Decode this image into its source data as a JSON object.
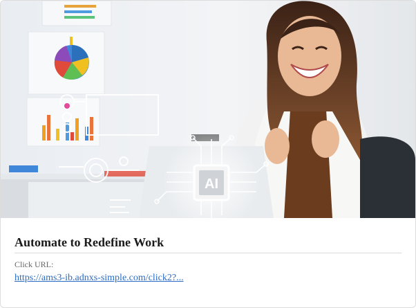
{
  "ad": {
    "image_alt": "Smiling woman celebrating in front of laptop with AI chip graphic",
    "chip_label": "AI",
    "title": "Automate to Redefine Work",
    "url_label": "Click URL:",
    "url_text": "https://ams3-ib.adnxs-simple.com/click2?..."
  },
  "colors": {
    "link": "#2a6cc4",
    "title": "#1b1b1b",
    "label": "#666666"
  }
}
